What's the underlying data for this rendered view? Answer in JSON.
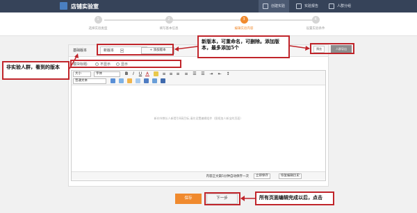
{
  "header": {
    "logo_text": "店铺实验室",
    "nav": [
      {
        "label": "创建实验",
        "icon": "pencil-icon",
        "active": true
      },
      {
        "label": "实验报告",
        "icon": "report-icon",
        "active": false
      },
      {
        "label": "人群分组",
        "icon": "group-icon",
        "active": false
      }
    ]
  },
  "steps": [
    {
      "num": "1",
      "label": "选择实验类型"
    },
    {
      "num": "2",
      "label": "填写基本信息"
    },
    {
      "num": "3",
      "label": "编辑实验内容"
    },
    {
      "num": "4",
      "label": "设置实验条件"
    }
  ],
  "tabs": {
    "base_version": "基础版本",
    "new_version": "新版本",
    "add_version": "+ 添加版本"
  },
  "module": {
    "label": "模块标题:",
    "option_hide": "不显示",
    "option_show": "显示"
  },
  "editor": {
    "size_select": "大小",
    "font_select": "字体",
    "format_select": "普通文本",
    "placeholder": "新向节教长人新提引8高目标,请先设置编辑组件（图框加人新宝的页面）",
    "status_text": "内容正文篇5分钟自动保存一次",
    "btn_save_draft": "立即保存",
    "btn_history": "恢复编辑历史"
  },
  "side": {
    "preview": "预览",
    "gray_label": "人群导出"
  },
  "buttons": {
    "save": "保存",
    "next": "下一步"
  },
  "annotations": {
    "new_version": "新版本，可重命名，可删除。添加版本，最多添加5个",
    "non_experiment": "非实验人群，看到的版本",
    "finish": "所有页面编辑完成以后，点击"
  },
  "colors": {
    "accent": "#f08a2e",
    "annotation_red": "#c0242a",
    "topbar": "#364359"
  }
}
